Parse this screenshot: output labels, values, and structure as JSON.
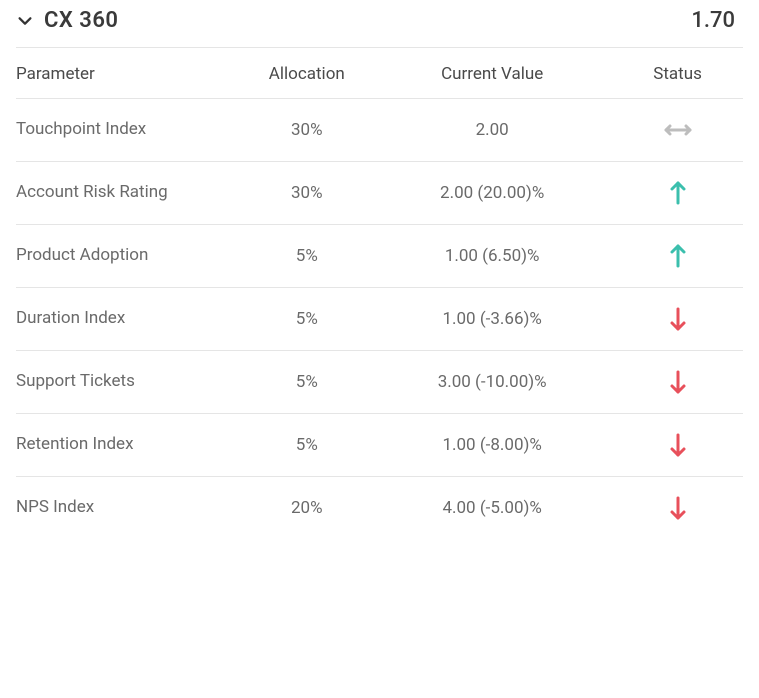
{
  "header": {
    "title": "CX 360",
    "score": "1.70"
  },
  "columns": {
    "parameter": "Parameter",
    "allocation": "Allocation",
    "current_value": "Current Value",
    "status": "Status"
  },
  "rows": [
    {
      "parameter": "Touchpoint Index",
      "allocation": "30%",
      "current_value": "2.00",
      "status": "flat"
    },
    {
      "parameter": "Account Risk Rating",
      "allocation": "30%",
      "current_value": "2.00 (20.00)%",
      "status": "up"
    },
    {
      "parameter": "Product Adoption",
      "allocation": "5%",
      "current_value": "1.00 (6.50)%",
      "status": "up"
    },
    {
      "parameter": "Duration Index",
      "allocation": "5%",
      "current_value": "1.00 (-3.66)%",
      "status": "down"
    },
    {
      "parameter": "Support Tickets",
      "allocation": "5%",
      "current_value": "3.00 (-10.00)%",
      "status": "down"
    },
    {
      "parameter": "Retention Index",
      "allocation": "5%",
      "current_value": "1.00 (-8.00)%",
      "status": "down"
    },
    {
      "parameter": "NPS Index",
      "allocation": "20%",
      "current_value": "4.00 (-5.00)%",
      "status": "down"
    }
  ]
}
